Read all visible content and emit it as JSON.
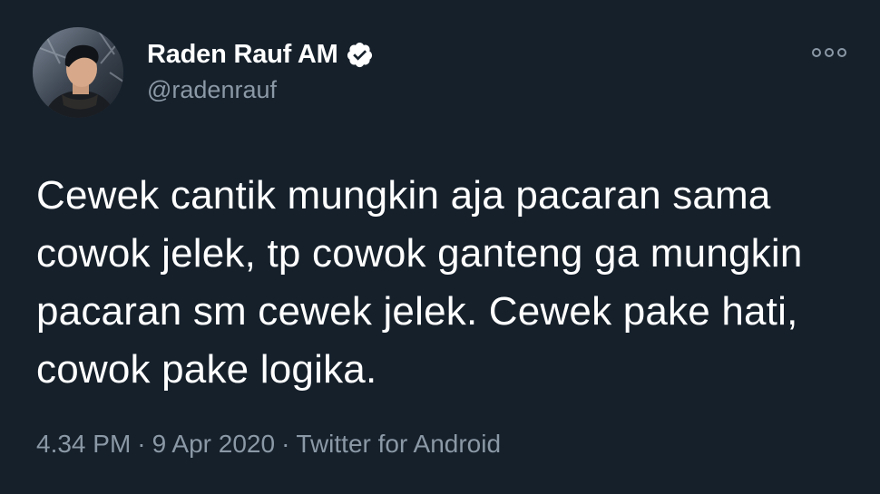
{
  "author": {
    "display_name": "Raden Rauf AM",
    "handle": "@radenrauf",
    "verified": true,
    "avatar_icon": "profile-photo"
  },
  "tweet": {
    "text": "Cewek cantik mungkin aja pacaran sama cowok jelek, tp cowok ganteng ga mungkin pacaran sm cewek jelek. Cewek pake hati, cowok pake logika."
  },
  "meta": {
    "time": "4.34 PM",
    "separator": "·",
    "date": "9 Apr 2020",
    "source": "Twitter for Android"
  },
  "icons": {
    "verified": "verified-badge-icon",
    "more": "more-options-icon"
  },
  "colors": {
    "background": "#15202b",
    "text": "#ffffff",
    "secondary_text": "#8b98a5"
  }
}
